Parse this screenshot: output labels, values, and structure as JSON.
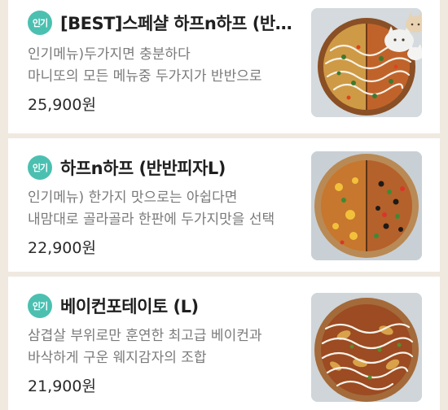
{
  "menu": {
    "items": [
      {
        "badge": "인기",
        "title": "[BEST]스페샬 하프n하프 (반반피자L)",
        "desc_line1": "인기메뉴)두가지면 충분하다",
        "desc_line2": "마니또의 모든 메뉴중 두가지가 반반으로",
        "price": "25,900원",
        "image_icon": "pizza-photo-with-cats-icon"
      },
      {
        "badge": "인기",
        "title": "하프n하프 (반반피자L)",
        "desc_line1": "인기메뉴) 한가지 맛으로는 아쉽다면",
        "desc_line2": "내맘대로 골라골라 한판에 두가지맛을 선택",
        "price": "22,900원",
        "image_icon": "half-half-pizza-photo-icon"
      },
      {
        "badge": "인기",
        "title": "베이컨포테이토 (L)",
        "desc_line1": "삼겹살 부위로만 훈연한 최고급 베이컨과",
        "desc_line2": "바삭하게 구운 웨지감자의 조합",
        "price": "21,900원",
        "image_icon": "bacon-potato-pizza-photo-icon"
      }
    ]
  },
  "colors": {
    "page_background": "#efe9e0",
    "card_background": "#ffffff",
    "badge_teal": "#4bc0b1",
    "title_text": "#1f1f1f",
    "description_text": "#7a7a7a"
  }
}
